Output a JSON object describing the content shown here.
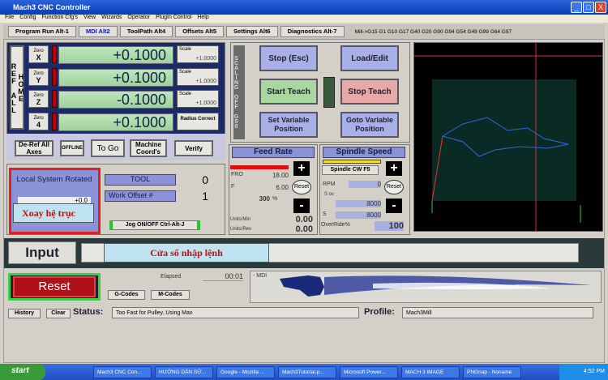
{
  "window": {
    "title": "Mach3 CNC Controller",
    "minimize": "_",
    "maximize": "□",
    "close": "X"
  },
  "menu": [
    "File",
    "Config",
    "Function Cfg's",
    "View",
    "Wizards",
    "Operator",
    "PlugIn Control",
    "Help"
  ],
  "tabs": [
    {
      "label": "Program Run Alt-1"
    },
    {
      "label": "MDI Alt2",
      "active": true
    },
    {
      "label": "ToolPath Alt4"
    },
    {
      "label": "Offsets Alt5"
    },
    {
      "label": "Settings Alt6"
    },
    {
      "label": "Diagnostics Alt-7"
    }
  ],
  "gcode_modal": "Mill->G15  G1 G10 G17 G40 G20 G90 G94 G54 G49 G99 G64 G97",
  "dro": {
    "ref_all_home": "REF ALL HOME",
    "axes": [
      {
        "zero": "Zero",
        "axis": "X",
        "value": "+0.1000",
        "side_label": "Scale",
        "side_value": "+1.0000"
      },
      {
        "zero": "Zero",
        "axis": "Y",
        "value": "+0.1000",
        "side_label": "Scale",
        "side_value": "+1.0000"
      },
      {
        "zero": "Zero",
        "axis": "Z",
        "value": "-0.1000",
        "side_label": "Scale",
        "side_value": "+1.0000"
      },
      {
        "zero": "Zero",
        "axis": "4",
        "value": "+0.1000",
        "side_label": "Radius Correct",
        "side_value": ""
      }
    ],
    "buttons": {
      "deref": "De-Ref All Axes",
      "offline": "OFFLINE",
      "togo": "To Go",
      "machine": "Machine Coord's",
      "verify": "Verify"
    }
  },
  "control": {
    "scaling": "SCALING OFF G50",
    "stop": "Stop (Esc)",
    "load": "Load/Edit",
    "start_teach": "Start Teach",
    "stop_teach": "Stop Teach",
    "set_var": "Set Variable Position",
    "goto_var": "Goto Variable Position"
  },
  "local_system": {
    "title": "Local System Rotated",
    "value": "+0.0",
    "annotation": "Xoay hệ trục"
  },
  "tool": {
    "label": "TOOL",
    "value": "0",
    "offset_label": "Work Offset #",
    "offset_value": "1",
    "jog": "Jog ON/OFF Ctrl-Alt-J"
  },
  "feed": {
    "title": "Feed Rate",
    "fro_label": "FRO",
    "fro": "18.00",
    "f_label": "F",
    "f": "6.00",
    "percent": "300",
    "pct_sign": "%",
    "reset": "Reset",
    "units_min_label": "Units/Min",
    "units_min": "0.00",
    "units_rev_label": "Units/Rev",
    "units_rev": "0.00",
    "plus": "+",
    "minus": "-"
  },
  "spindle": {
    "title": "Spindle Speed",
    "cw": "Spindle CW F5",
    "rpm_label": "RPM",
    "rpm": "0",
    "sov_label": "S ov",
    "sov": "8000",
    "s_label": "S",
    "s": "8000",
    "override_label": "OverRide%",
    "override": "100",
    "reset": "Reset",
    "plus": "+",
    "minus": "-"
  },
  "input": {
    "label": "Input",
    "annotation": "Cửa sổ nhập lệnh"
  },
  "bottom": {
    "reset": "Reset",
    "elapsed_label": "Elapsed",
    "elapsed": "00:01",
    "gcodes": "G-Codes",
    "mcodes": "M-Codes",
    "mode": "- MDI",
    "history": "History",
    "clear": "Clear",
    "status_label": "Status:",
    "status": "Too Fast for Pulley..Using Max",
    "profile_label": "Profile:",
    "profile": "Mach3Mill"
  },
  "taskbar": {
    "start": "start",
    "items": [
      "Mach3 CNC Con...",
      "HƯỚNG DẪN SỬ...",
      "Google - Mozilla ...",
      "Mach3Tutorial.p...",
      "Microsoft Power...",
      "MACH 3 IMAGE",
      "PNGnap - Noname"
    ],
    "clock": "4:52 PM"
  }
}
